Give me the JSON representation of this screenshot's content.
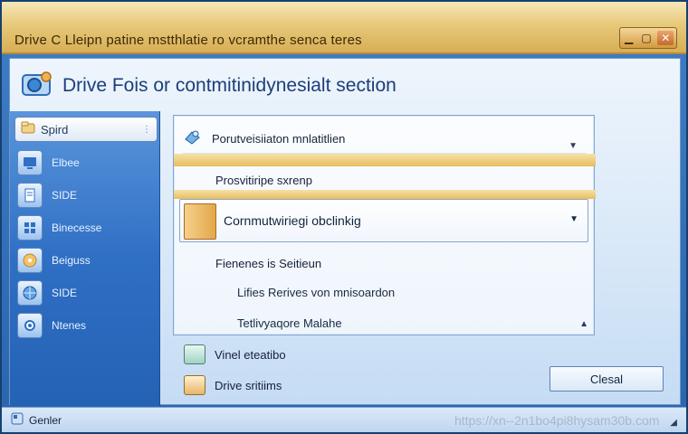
{
  "window": {
    "title": "Drive C Lleipn patine mstthlatie ro vcramthe senca teres"
  },
  "header": {
    "title": "Drive Fois or contmitinidynesialt section"
  },
  "sidebar": {
    "search_label": "Spird",
    "items": [
      {
        "label": "Elbee",
        "icon": "monitor-icon"
      },
      {
        "label": "SIDE",
        "icon": "document-icon"
      },
      {
        "label": "Binecesse",
        "icon": "grid-icon"
      },
      {
        "label": "Beiguss",
        "icon": "disc-icon"
      },
      {
        "label": "SIDE",
        "icon": "globe-icon"
      },
      {
        "label": "Ntenes",
        "icon": "settings-icon"
      }
    ]
  },
  "panel": {
    "top_item": "Porutveisiiaton mnlatitlien",
    "section1_label": "Prosvitiripe sxrenp",
    "combo_value": "Cornmutwiriegi obclinkig",
    "section2_label": "Fienenes is Seitieun",
    "list_items": [
      "Lifies Rerives von mnisoardon",
      "Tetlivyaqore Malahe"
    ]
  },
  "bottom": {
    "item1": "Vinel eteatibo",
    "item2": "Drive sritiims"
  },
  "buttons": {
    "close_label": "Clesal"
  },
  "statusbar": {
    "left_label": "Genler",
    "watermark": "https://xn--2n1bo4pi8hysam30b.com"
  }
}
